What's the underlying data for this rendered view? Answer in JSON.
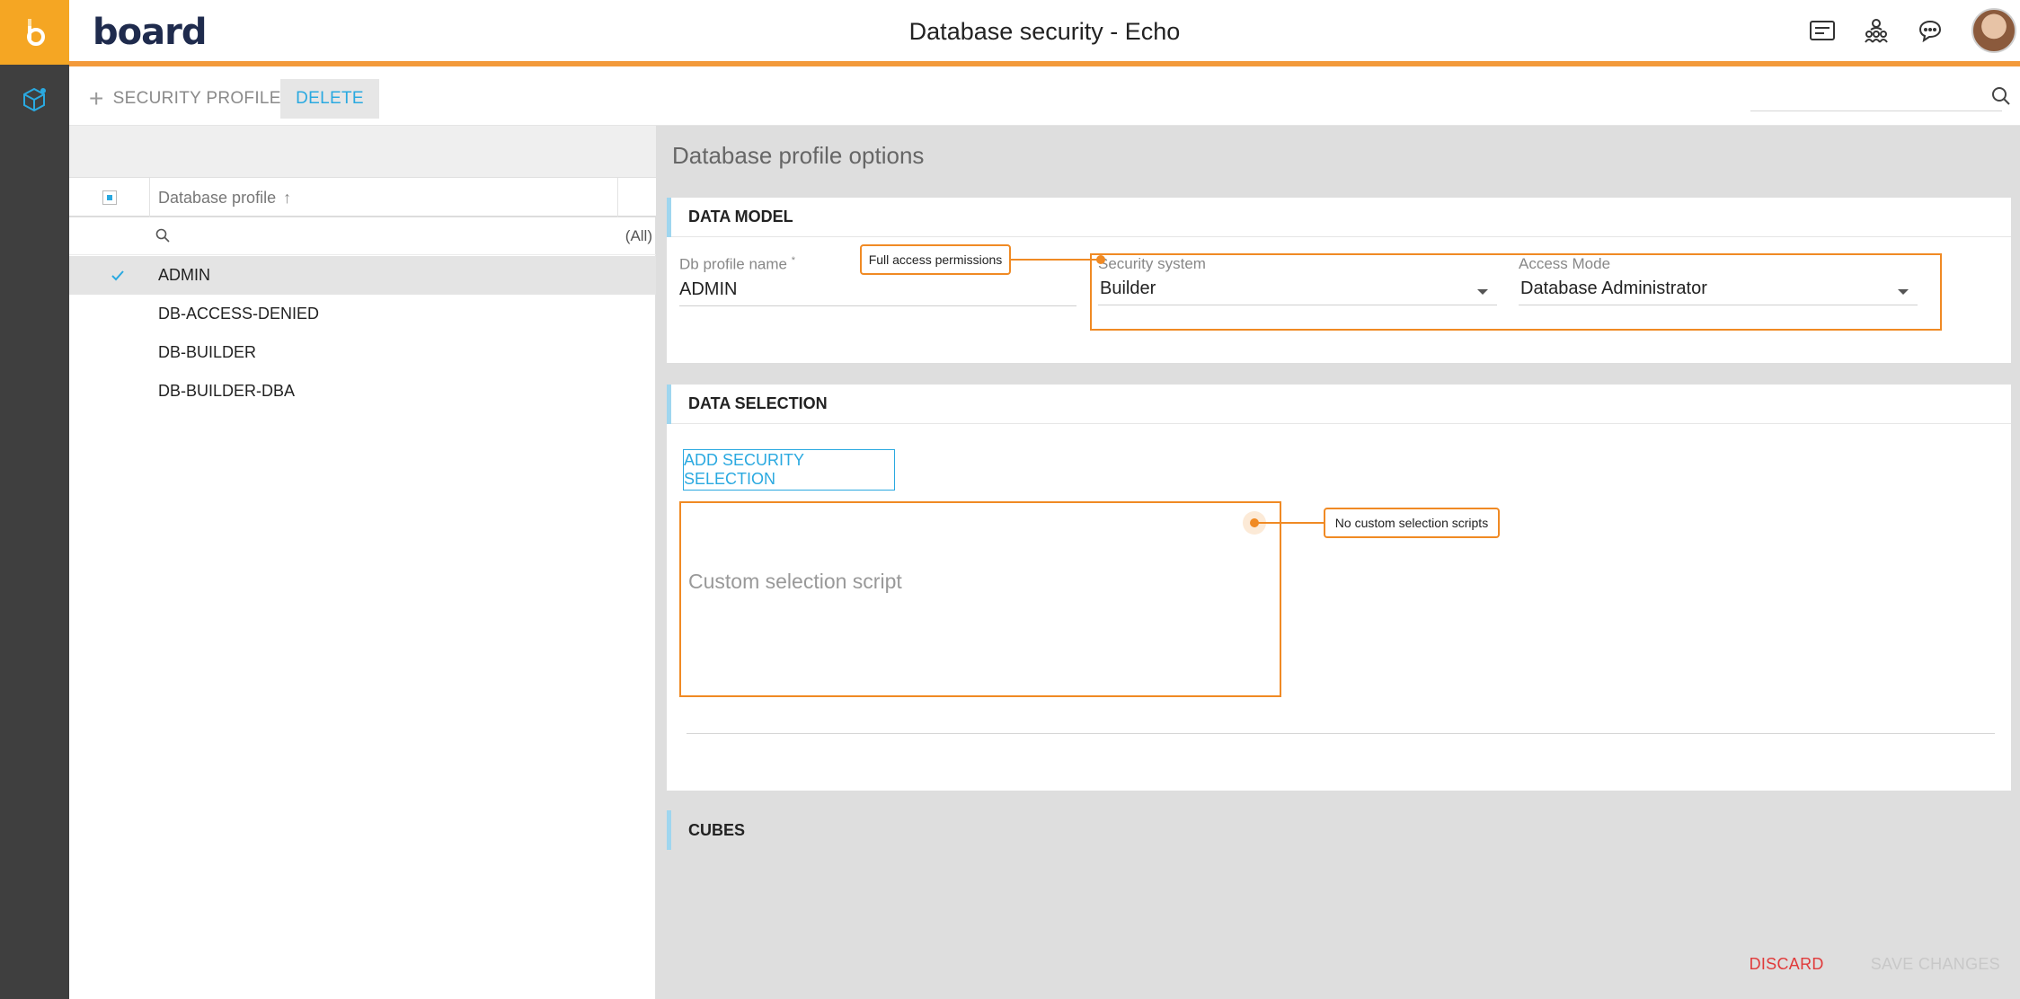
{
  "app": {
    "title": "Database security - Echo",
    "brand": "board",
    "brand_accent": "#f5a623",
    "accent_blue": "#2aa9e0",
    "header_bar_color": "#f39a3a"
  },
  "header_icons": [
    "list-card-icon",
    "users-hierarchy-icon",
    "chat-bubble-icon",
    "user-avatar"
  ],
  "toolbar": {
    "add_label": "SECURITY PROFILE",
    "delete_label": "DELETE",
    "search_placeholder": ""
  },
  "profile_list": {
    "column_header": "Database profile",
    "filter_all": "(All)",
    "rows": [
      {
        "label": "ADMIN",
        "selected": true
      },
      {
        "label": "DB-ACCESS-DENIED",
        "selected": false
      },
      {
        "label": "DB-BUILDER",
        "selected": false
      },
      {
        "label": "DB-BUILDER-DBA",
        "selected": false
      }
    ]
  },
  "content": {
    "title": "Database profile options",
    "data_model": {
      "heading": "DATA MODEL",
      "db_profile_name_label": "Db profile name",
      "db_profile_name_required": "*",
      "db_profile_name_value": "ADMIN",
      "security_system_label": "Security system",
      "security_system_value": "Builder",
      "access_mode_label": "Access Mode",
      "access_mode_value": "Database Administrator"
    },
    "data_selection": {
      "heading": "DATA SELECTION",
      "add_button": "ADD SECURITY SELECTION",
      "script_placeholder": "Custom selection script"
    },
    "cubes": {
      "heading": "CUBES"
    }
  },
  "footer": {
    "discard": "DISCARD",
    "save": "SAVE CHANGES"
  },
  "annotations": {
    "full_access": "Full access permissions",
    "no_custom_scripts": "No custom selection scripts"
  }
}
